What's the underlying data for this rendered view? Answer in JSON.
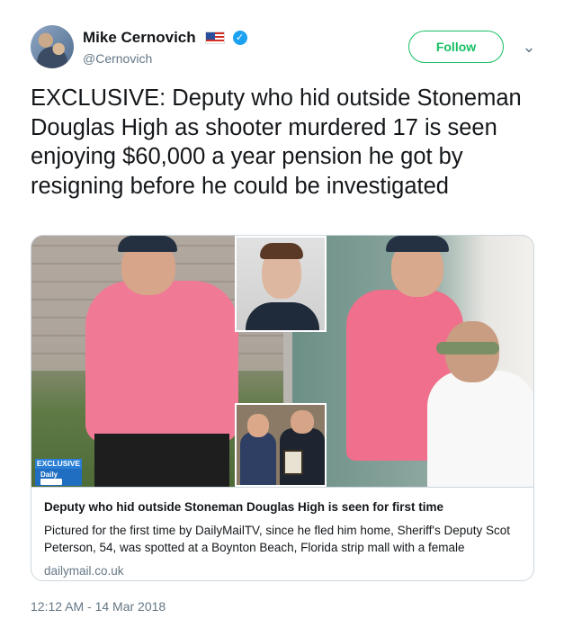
{
  "author": {
    "name": "Mike Cernovich",
    "handle": "@Cernovich",
    "flag_icon": "us-flag-icon",
    "verified_icon": "verified-badge-icon",
    "verified_glyph": "✓"
  },
  "actions": {
    "follow_label": "Follow",
    "menu_icon": "chevron-down-icon",
    "menu_glyph": "⌄"
  },
  "tweet": {
    "text": "EXCLUSIVE: Deputy who hid outside Stoneman Douglas High as shooter murdered 17 is seen enjoying $60,000 a year pension he got by resigning before he could be investigated",
    "timestamp": "12:12 AM - 14 Mar 2018"
  },
  "card": {
    "badge_top": "EXCLUSIVE",
    "badge_bottom": "Daily",
    "title": "Deputy who hid outside Stoneman Douglas High is seen for first time",
    "description": "Pictured for the first time by DailyMailTV, since he fled him home, Sheriff's Deputy Scot Peterson, 54, was spotted at a Boynton Beach, Florida strip mall with a female",
    "domain": "dailymail.co.uk"
  },
  "colors": {
    "follow_green": "#17bf63",
    "verified_blue": "#1da1f2",
    "text_primary": "#14171a",
    "text_secondary": "#657786",
    "card_border": "#ccd6dd"
  }
}
